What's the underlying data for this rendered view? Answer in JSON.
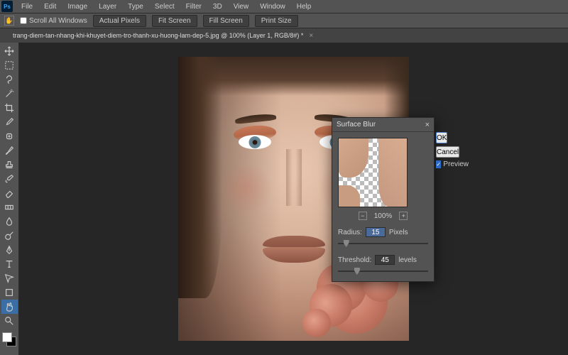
{
  "menu": {
    "items": [
      "File",
      "Edit",
      "Image",
      "Layer",
      "Type",
      "Select",
      "Filter",
      "3D",
      "View",
      "Window",
      "Help"
    ]
  },
  "options": {
    "scroll_all": "Scroll All Windows",
    "actual_pixels": "Actual Pixels",
    "fit_screen": "Fit Screen",
    "fill_screen": "Fill Screen",
    "print_size": "Print Size"
  },
  "doc": {
    "title": "trang-diem-tan-nhang-khi-khuyet-diem-tro-thanh-xu-huong-lam-dep-5.jpg @ 100% (Layer 1, RGB/8#) *",
    "close": "×"
  },
  "dialog": {
    "title": "Surface Blur",
    "close": "×",
    "ok": "OK",
    "cancel": "Cancel",
    "preview": "Preview",
    "zoom": "100%",
    "plus": "+",
    "minus": "−",
    "radius_label": "Radius:",
    "radius_value": "15",
    "radius_unit": "Pixels",
    "threshold_label": "Threshold:",
    "threshold_value": "45",
    "threshold_unit": "levels"
  }
}
